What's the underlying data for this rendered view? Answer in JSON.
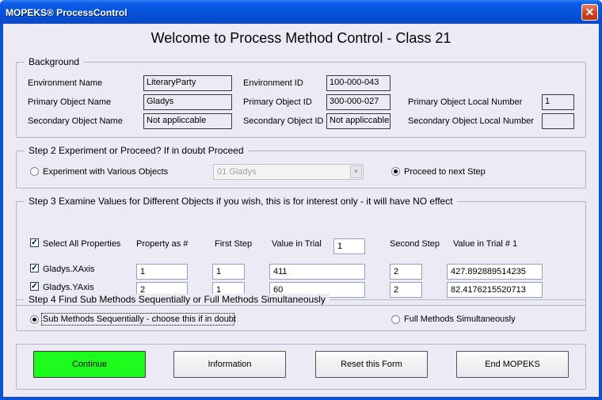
{
  "window": {
    "title": "MOPEKS® ProcessControl",
    "close_glyph": "✕"
  },
  "main_title": "Welcome to Process Method Control - Class 21",
  "background": {
    "title": "Background",
    "env_name_label": "Environment Name",
    "env_name_value": "LiteraryParty",
    "env_id_label": "Environment ID",
    "env_id_value": "100-000-043",
    "primary_name_label": "Primary Object Name",
    "primary_name_value": "Gladys",
    "primary_id_label": "Primary Object ID",
    "primary_id_value": "300-000-027",
    "primary_local_label": "Primary Object Local Number",
    "primary_local_value": "1",
    "secondary_name_label": "Secondary Object Name",
    "secondary_name_value": "Not appliccable",
    "secondary_id_label": "Secondary Object ID",
    "secondary_id_value": "Not appliccable",
    "secondary_local_label": "Secondary Object Local Number",
    "secondary_local_value": ""
  },
  "step2": {
    "title": "Step 2    Experiment or Proceed?  If in doubt Proceed",
    "experiment_label": "Experiment with Various Objects",
    "combo_value": "01    Gladys",
    "combo_arrow": "▼",
    "proceed_label": "Proceed to next Step"
  },
  "step3": {
    "title": "Step 3  Examine Values for Different Objects if you wish, this is for interest only - it will have NO effect",
    "select_all_label": "Select All Properties",
    "col_property": "Property as #",
    "col_first_step": "First Step",
    "col_value_trial": "Value in Trial",
    "trial_input": "1",
    "col_second_step": "Second Step",
    "col_value_trial1": "Value in Trial # 1",
    "check_glyph": "✓",
    "rows": [
      {
        "name": "Gladys.XAxis",
        "property": "1",
        "first_step": "1",
        "value_trial": "411",
        "second_step": "2",
        "value_trial1": "427.892889514235"
      },
      {
        "name": "Gladys.YAxis",
        "property": "2",
        "first_step": "1",
        "value_trial": "60",
        "second_step": "2",
        "value_trial1": "82.4176215520713"
      }
    ]
  },
  "step4": {
    "title": "Step 4   Find Sub Methods Sequentially or Full  Methods Simultaneously",
    "sub_label": "Sub Methods Sequentially - choose this if in doubt",
    "full_label": "Full  Methods Simultaneously"
  },
  "buttons": {
    "continue": "Continue",
    "information": "Information",
    "reset": "Reset this Form",
    "end": "End MOPEKS"
  },
  "colors": {
    "title_bar": "#0a5ce8",
    "client_bg": "#ebeaf5",
    "continue_green": "#1dfc1d"
  }
}
